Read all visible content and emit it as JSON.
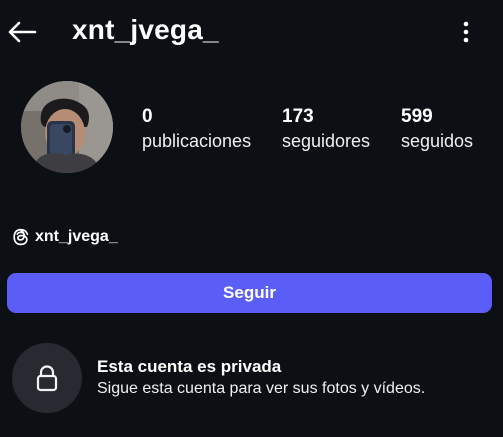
{
  "header": {
    "username": "xnt_jvega_",
    "back_icon": "arrow-left-icon",
    "more_icon": "more-vertical-icon"
  },
  "profile": {
    "avatar_icon": "profile-photo",
    "stats": [
      {
        "value": "0",
        "label": "publicaciones"
      },
      {
        "value": "173",
        "label": "seguidores"
      },
      {
        "value": "599",
        "label": "seguidos"
      }
    ],
    "threads_handle": "xnt_jvega_",
    "threads_icon": "threads-icon"
  },
  "actions": {
    "follow_label": "Seguir"
  },
  "private_notice": {
    "title": "Esta cuenta es privada",
    "subtitle": "Sigue esta cuenta para ver sus fotos y vídeos.",
    "icon": "lock-icon"
  },
  "colors": {
    "background": "#0c0f14",
    "accent": "#5b5ef6",
    "lock_circle": "#272b31"
  }
}
